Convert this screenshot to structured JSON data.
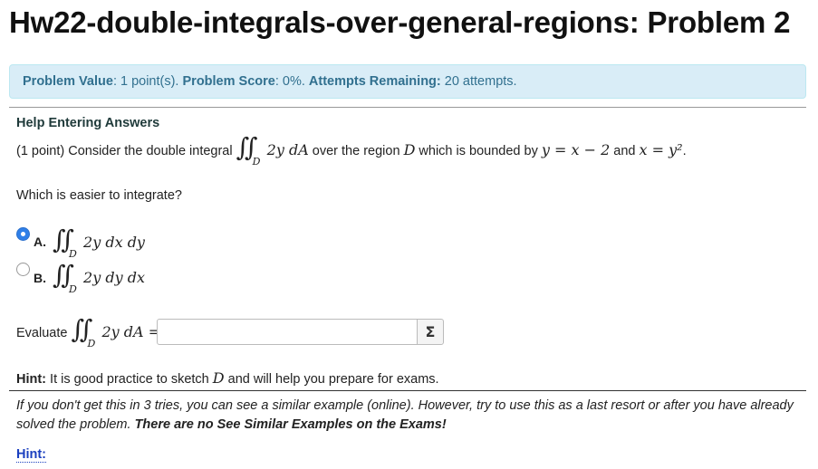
{
  "title": "Hw22-double-integrals-over-general-regions: Problem 2",
  "info": {
    "value_label": "Problem Value",
    "value_text": ": 1 point(s). ",
    "score_label": "Problem Score",
    "score_text": ": 0%. ",
    "attempts_label": "Attempts Remaining:",
    "attempts_text": " 20 attempts."
  },
  "help_link": "Help Entering Answers",
  "problem": {
    "prefix": "(1 point) Consider the double integral",
    "integrand": "2y dA",
    "region_sym": "D",
    "mid": "over the region",
    "region": "D",
    "bounded": "which is bounded by",
    "curve1": "y = x − 2",
    "and": "and",
    "curve2": "x = y²",
    "period": "."
  },
  "question": "Which is easier to integrate?",
  "options": [
    {
      "label": "A.",
      "integrand": "2y dx dy",
      "sub": "D",
      "selected": true
    },
    {
      "label": "B.",
      "integrand": "2y dy dx",
      "sub": "D",
      "selected": false
    }
  ],
  "evaluate": {
    "label": "Evaluate",
    "integrand": "2y dA =",
    "sub": "D",
    "value": "",
    "sigma": "Σ"
  },
  "hint": {
    "label": "Hint:",
    "text_before": " It is good practice to sketch ",
    "region": "D",
    "text_after": " and will help you prepare for exams."
  },
  "note": {
    "text": "If you don't get this in 3 tries, you can see a similar example (online). However, try to use this as a last resort or after you have already solved the problem. ",
    "bold": "There are no See Similar Examples on the Exams!"
  },
  "hint_link": "Hint:"
}
